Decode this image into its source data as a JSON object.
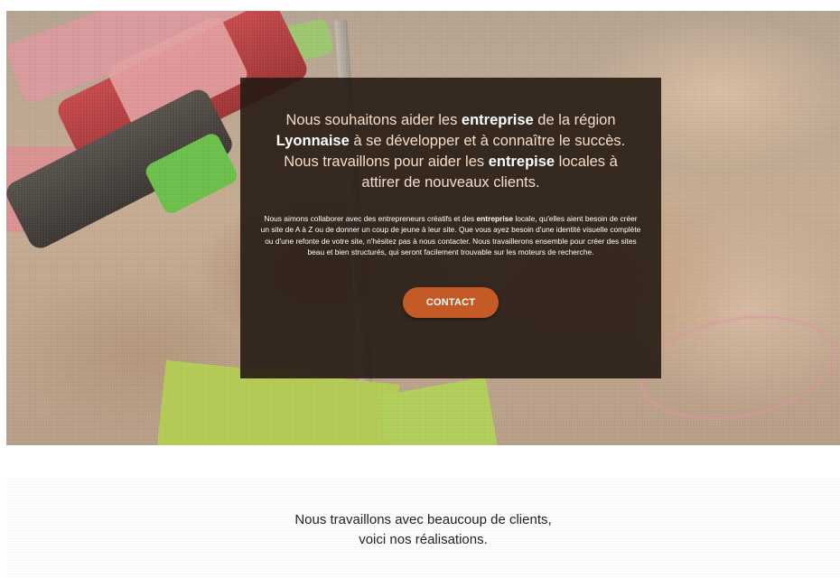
{
  "hero": {
    "headline": {
      "part1": "Nous souhaitons aider les ",
      "bold1": "entreprise",
      "part2": " de la région ",
      "bold2": "Lyonnaise",
      "part3": " à se développer et à connaître le succès. Nous travaillons pour aider les ",
      "bold3": "entrepise",
      "part4": " locales à attirer de nouveaux clients."
    },
    "body": {
      "part1": "Nous aimons collaborer avec des entrepreneurs créatifs et des ",
      "bold1": "entreprise",
      "part2": " locale, qu'elles aient besoin de créer un site de A à Z ou de donner un coup de jeune à leur site. Que vous ayez besoin d'une identité visuelle complète ou d'une refonte de votre site, n'hésitez pas à nous contacter. Nous travaillerons ensemble pour créer des sites beau et bien structurés, qui seront facilement trouvable sur les moteurs de recherche."
    },
    "cta_label": "CONTACT"
  },
  "works": {
    "line1": "Nous travaillons avec beaucoup de clients,",
    "line2": "voici nos réalisations."
  },
  "colors": {
    "overlay": "#261b13",
    "headline_text": "#f6dcc7",
    "cta_background": "#c45a26"
  }
}
